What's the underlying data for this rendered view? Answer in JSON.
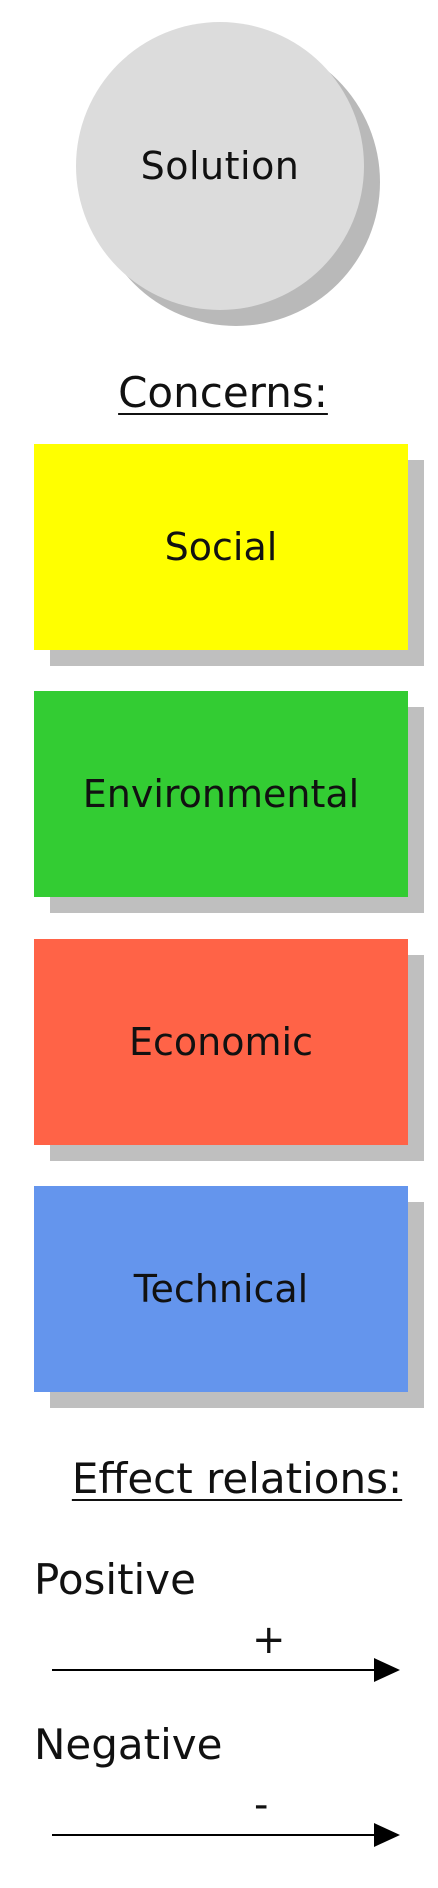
{
  "solution": {
    "label": "Solution",
    "fill": "#dcdcdc"
  },
  "concerns": {
    "heading": "Concerns:",
    "items": [
      {
        "label": "Social",
        "color": "#ffff00"
      },
      {
        "label": "Environmental",
        "color": "#33cc33"
      },
      {
        "label": "Economic",
        "color": "#ff6347"
      },
      {
        "label": "Technical",
        "color": "#6495ed"
      }
    ]
  },
  "effect_relations": {
    "heading": "Effect relations:",
    "positive": {
      "label": "Positive",
      "sign": "+"
    },
    "negative": {
      "label": "Negative",
      "sign": "-"
    }
  }
}
